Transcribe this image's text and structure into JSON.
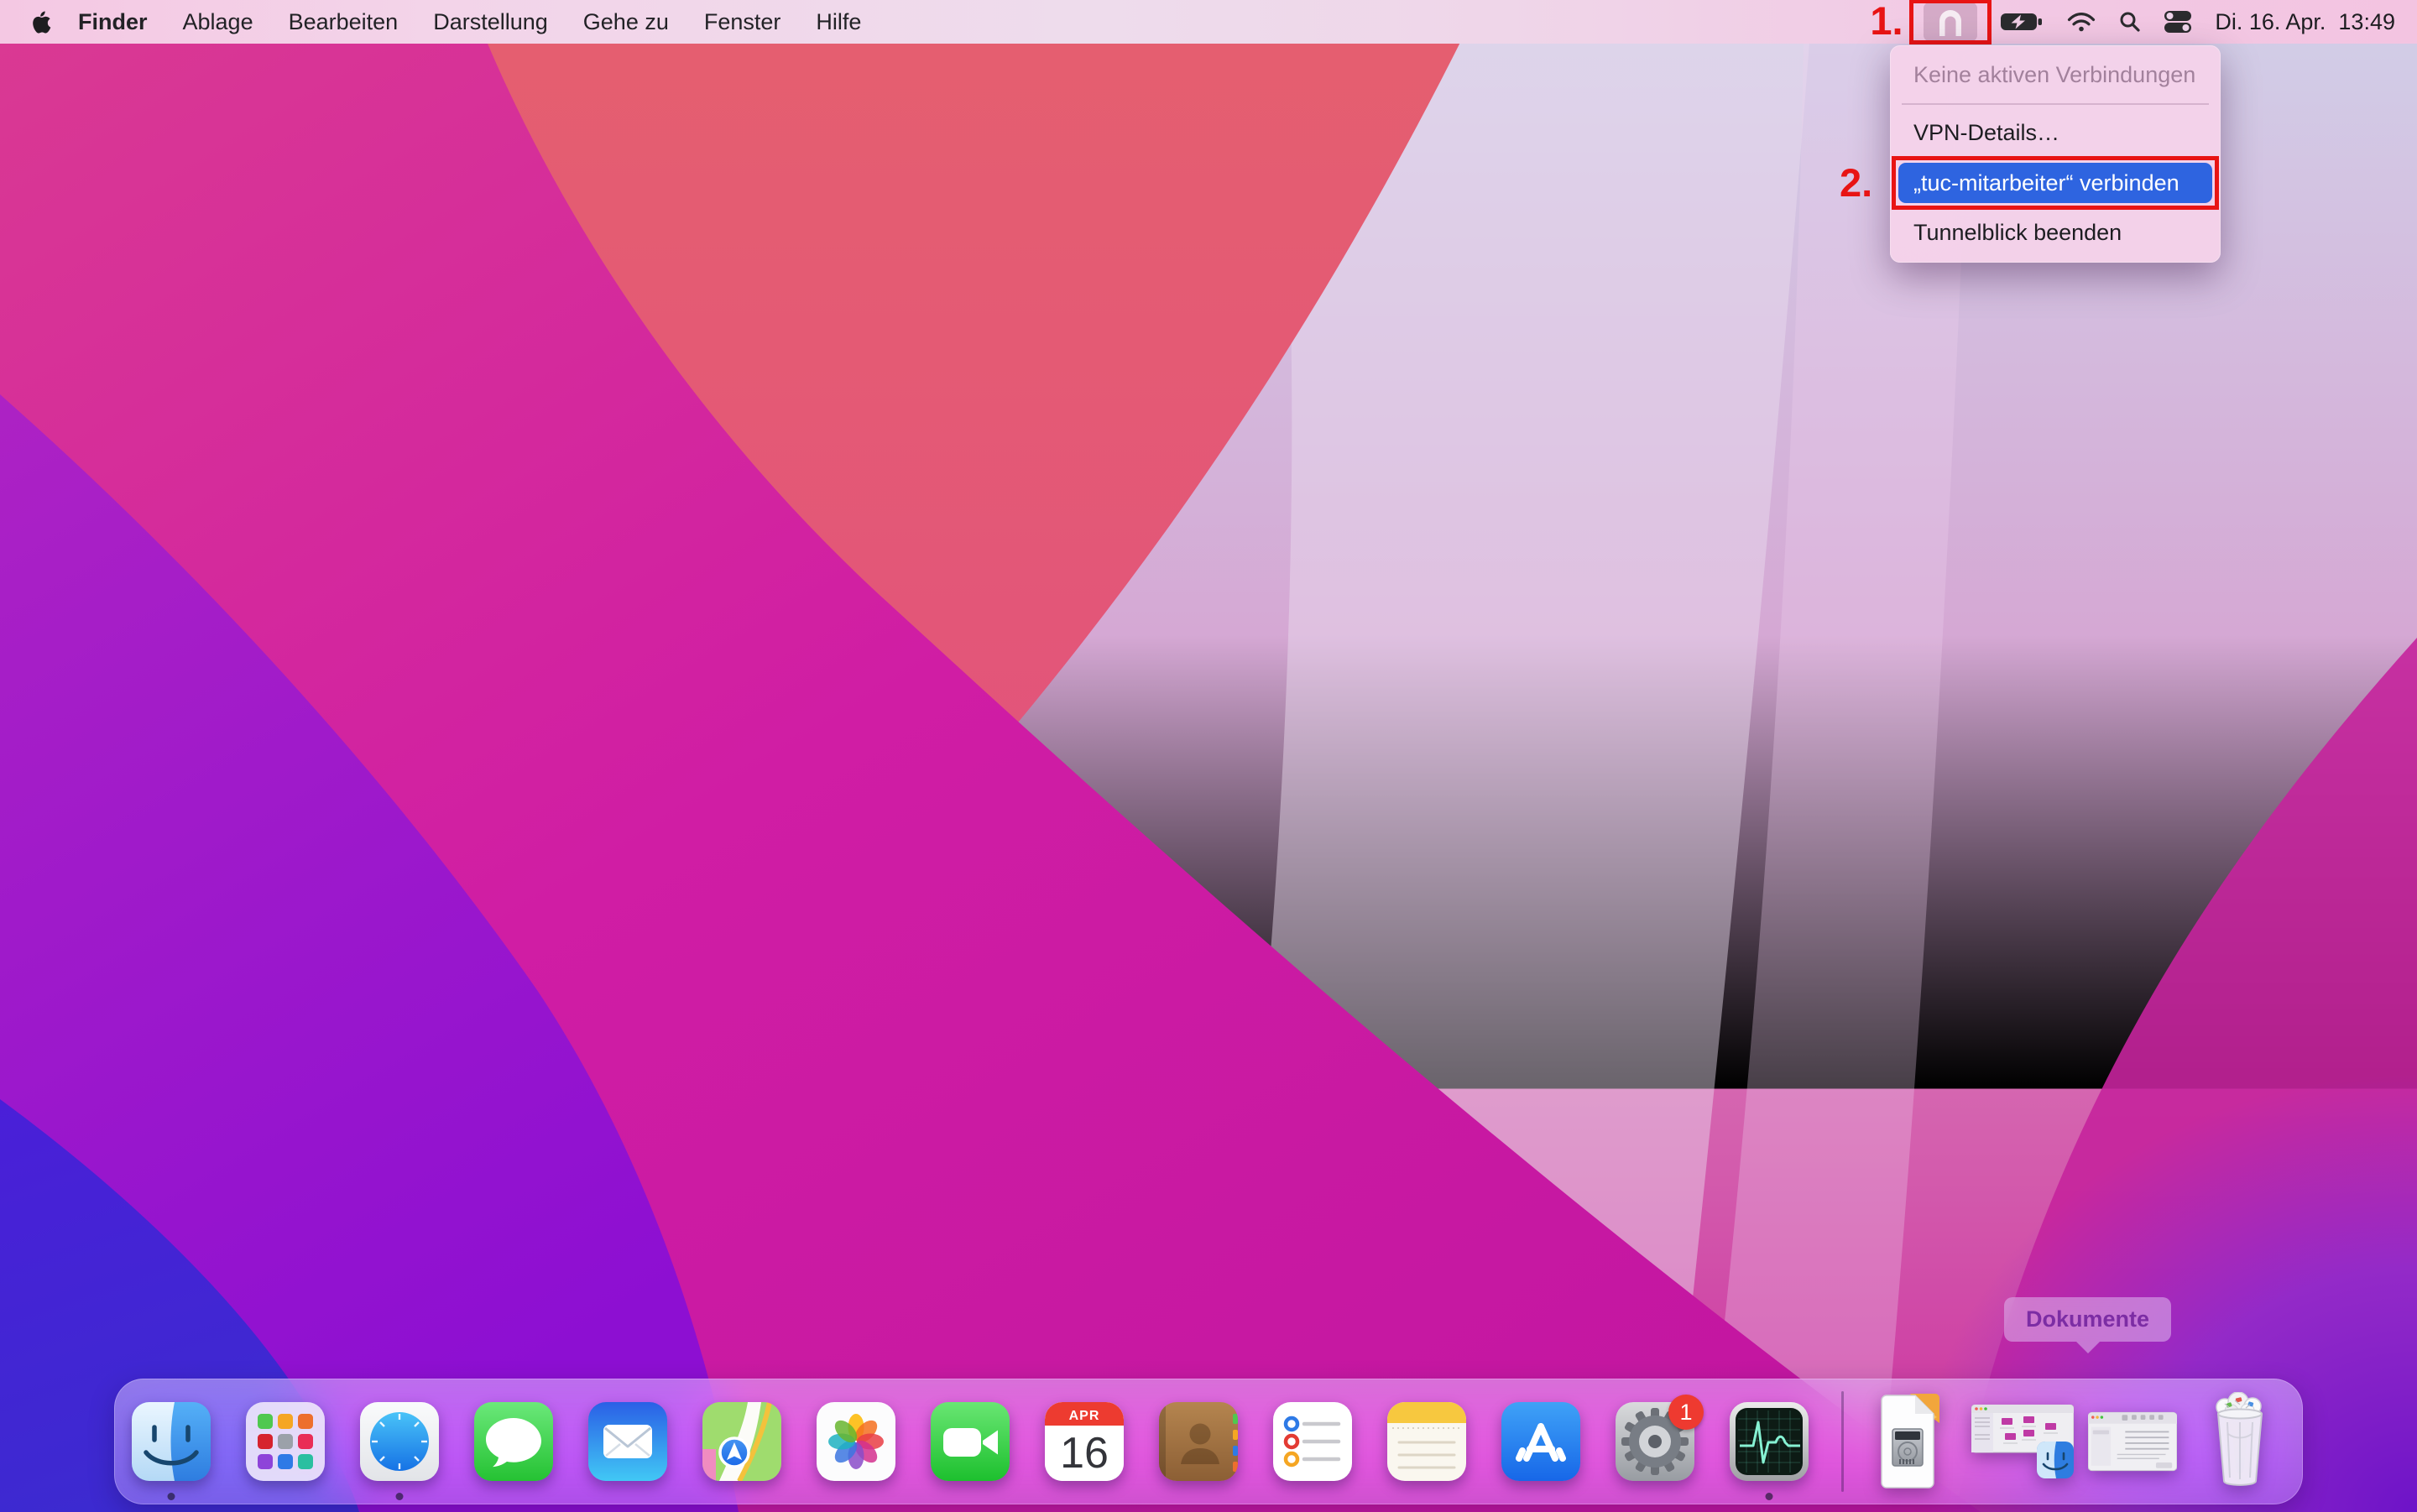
{
  "menubar": {
    "items": [
      "Finder",
      "Ablage",
      "Bearbeiten",
      "Darstellung",
      "Gehe zu",
      "Fenster",
      "Hilfe"
    ],
    "status_icons": [
      "tunnelblick-icon",
      "battery-charging-icon",
      "wifi-icon",
      "spotlight-search-icon",
      "control-center-icon"
    ],
    "clock": "Di. 16. Apr.  13:49"
  },
  "vpn_menu": {
    "items": [
      {
        "label": "Keine aktiven Verbindungen",
        "disabled": true
      },
      {
        "label": "VPN-Details…",
        "disabled": false
      },
      {
        "label": "„tuc-mitarbeiter“ verbinden",
        "highlighted": true
      },
      {
        "label": "Tunnelblick beenden",
        "disabled": false
      }
    ]
  },
  "annotations": {
    "step1": "1.",
    "step2": "2.",
    "color": "#e81414"
  },
  "dock": {
    "items": [
      "finder",
      "launchpad",
      "safari",
      "messages",
      "mail",
      "maps",
      "photos",
      "facetime",
      "calendar",
      "contacts",
      "reminders",
      "notes",
      "app-store",
      "system-preferences",
      "activity-monitor",
      "separator",
      "documents-stack",
      "finder-window-thumbnail",
      "settings-window-thumbnail",
      "trash"
    ],
    "running_indicators": [
      "finder",
      "safari",
      "activity-monitor"
    ],
    "calendar": {
      "month": "APR",
      "day": "16"
    },
    "settings_badge": "1",
    "tooltip": "Dokumente"
  },
  "colors": {
    "menu_highlight_blue": "#2e64e0",
    "annotation_red": "#e81414",
    "badge_red": "#ee3a30"
  }
}
